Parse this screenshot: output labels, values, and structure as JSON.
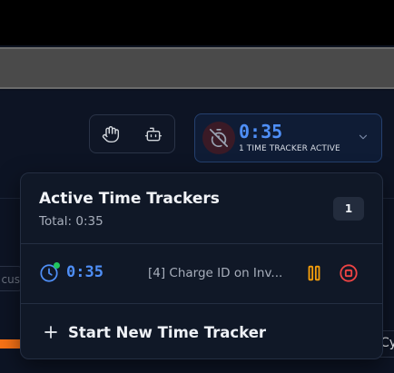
{
  "header": {
    "icons": {
      "hand": "hand-icon",
      "bot": "bot-icon"
    }
  },
  "tracker_button": {
    "time": "0:35",
    "status": "1 TIME TRACKER ACTIVE",
    "icon": "timer-off-icon",
    "chevron": "chevron-down-icon"
  },
  "background": {
    "input_partial_text": "cus",
    "chip_partial_text": "Cy"
  },
  "dropdown": {
    "title": "Active Time Trackers",
    "total": "Total: 0:35",
    "count": "1",
    "trackers": [
      {
        "time": "0:35",
        "task": "[4] Charge ID on Inv...",
        "status_color": "#22c55e",
        "pause_color": "#f59e0b",
        "stop_color": "#ef4444"
      }
    ],
    "new_tracker_label": "Start New Time Tracker"
  },
  "colors": {
    "accent": "#4f8ff7",
    "background": "#0d1424",
    "panel": "#101827"
  }
}
